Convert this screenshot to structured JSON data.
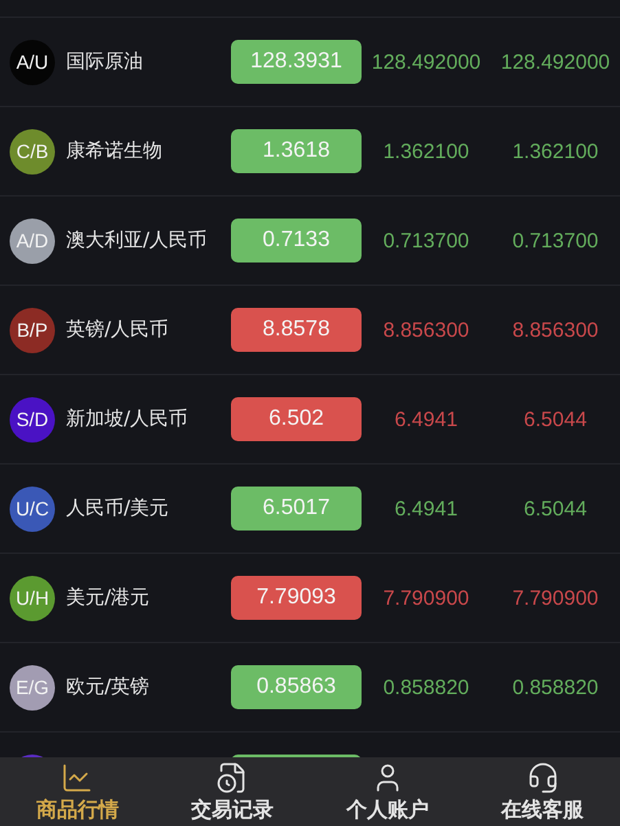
{
  "quotes": [
    {
      "code": "A/U",
      "name": "国际原油",
      "color": "#050505",
      "rising": true,
      "price": "128.3931",
      "col_2": "128.492000",
      "col_3": "128.492000"
    },
    {
      "code": "C/B",
      "name": "康希诺生物",
      "color": "#6e8c2c",
      "rising": true,
      "price": "1.3618",
      "col_2": "1.362100",
      "col_3": "1.362100"
    },
    {
      "code": "A/D",
      "name": "澳大利亚/人民币",
      "color": "#9a9fa9",
      "rising": true,
      "price": "0.7133",
      "col_2": "0.713700",
      "col_3": "0.713700"
    },
    {
      "code": "B/P",
      "name": "英镑/人民币",
      "color": "#8c2b24",
      "rising": false,
      "price": "8.8578",
      "col_2": "8.856300",
      "col_3": "8.856300"
    },
    {
      "code": "S/D",
      "name": "新加坡/人民币",
      "color": "#4a12c4",
      "rising": false,
      "price": "6.502",
      "col_2": "6.4941",
      "col_3": "6.5044"
    },
    {
      "code": "U/C",
      "name": "人民币/美元",
      "color": "#3a58b6",
      "rising": true,
      "price": "6.5017",
      "col_2": "6.4941",
      "col_3": "6.5044"
    },
    {
      "code": "U/H",
      "name": "美元/港元",
      "color": "#5b9a30",
      "rising": false,
      "price": "7.79093",
      "col_2": "7.790900",
      "col_3": "7.790900"
    },
    {
      "code": "E/G",
      "name": "欧元/英镑",
      "color": "#a29cb2",
      "rising": true,
      "price": "0.85863",
      "col_2": "0.858820",
      "col_3": "0.858820"
    },
    {
      "color": "#5a2cc2",
      "rising": true
    }
  ],
  "tab_bar": [
    {
      "kind": "chart",
      "label": "商品行情",
      "selected": true
    },
    {
      "kind": "records",
      "label": "交易记录",
      "selected": false
    },
    {
      "kind": "person",
      "label": "个人账户",
      "selected": false
    },
    {
      "kind": "support",
      "label": "在线客服",
      "selected": false
    }
  ]
}
